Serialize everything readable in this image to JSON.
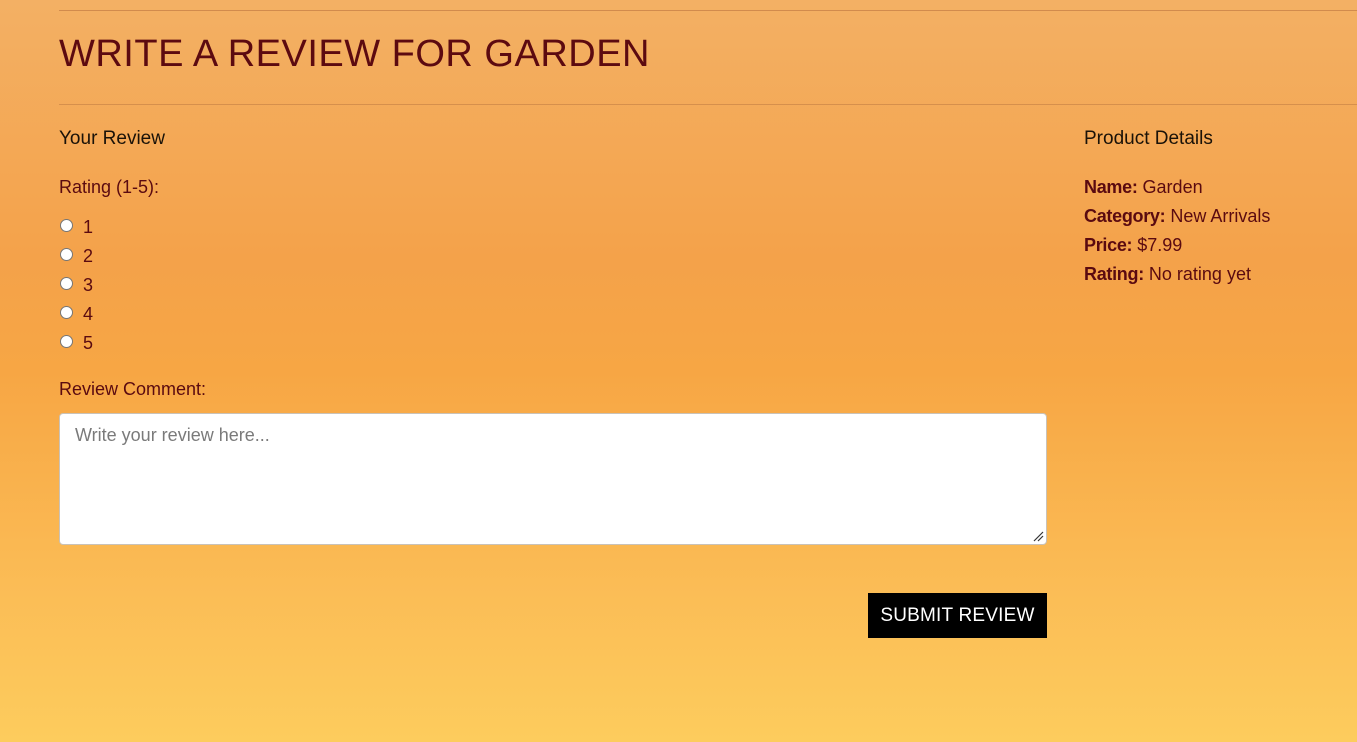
{
  "page": {
    "title": "WRITE A REVIEW FOR GARDEN"
  },
  "review": {
    "heading": "Your Review",
    "rating_label": "Rating (1-5):",
    "rating_options": [
      "1",
      "2",
      "3",
      "4",
      "5"
    ],
    "comment_label": "Review Comment:",
    "comment_placeholder": "Write your review here...",
    "comment_value": "",
    "submit_label": "SUBMIT REVIEW"
  },
  "product": {
    "heading": "Product Details",
    "details": [
      {
        "key": "Name:",
        "value": "Garden"
      },
      {
        "key": "Category:",
        "value": "New Arrivals"
      },
      {
        "key": "Price:",
        "value": "$7.99"
      },
      {
        "key": "Rating:",
        "value": "No rating yet"
      }
    ]
  },
  "colors": {
    "title": "#5c0a10",
    "text": "#5a0a10",
    "button_bg": "#000000",
    "button_text": "#ffffff",
    "gradient_top": "#f3b064",
    "gradient_bottom": "#fdcc5d"
  },
  "icons": {
    "resize_grip": "resize-grip-icon"
  }
}
